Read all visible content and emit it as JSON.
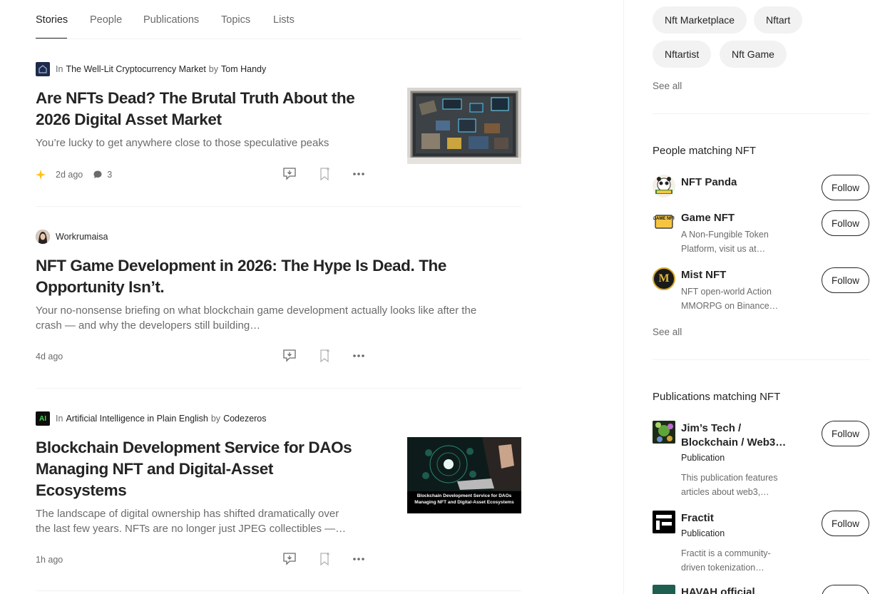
{
  "tabs": [
    "Stories",
    "People",
    "Publications",
    "Topics",
    "Lists"
  ],
  "stories": [
    {
      "in_label": "In",
      "publication": "The Well-Lit Cryptocurrency Market",
      "by_label": "by",
      "author": "Tom Handy",
      "title_line1": "Are NFTs Dead? The Brutal Truth About the",
      "title_line2": "2026 Digital Asset Market",
      "subtitle": "You’re lucky to get anywhere close to those speculative peaks",
      "age": "2d ago",
      "comments": "3"
    },
    {
      "author": "Workrumaisa",
      "title_line1": "NFT Game Development in 2026: The Hype Is Dead. The",
      "title_line2": "Opportunity Isn’t.",
      "subtitle_line1": "Your no-nonsense briefing on what blockchain game development actually looks like after the",
      "subtitle_line2": "crash — and why the developers still building…",
      "age": "4d ago"
    },
    {
      "in_label": "In",
      "publication": "Artificial Intelligence in Plain English",
      "by_label": "by",
      "author": "Codezeros",
      "pub_icon_text": "AI",
      "title_line1": "Blockchain Development Service for DAOs",
      "title_line2": "Managing NFT and Digital-Asset",
      "title_line3": "Ecosystems",
      "subtitle_line1": "The landscape of digital ownership has shifted dramatically over",
      "subtitle_line2": "the last few years. NFTs are no longer just JPEG collectibles —…",
      "age": "1h ago",
      "thumb_caption_line1": "Blockchain Development Service for DAOs",
      "thumb_caption_line2": "Managing NFT and Digital-Asset Ecosystems"
    }
  ],
  "sidebar": {
    "topics": [
      "Nft Marketplace",
      "Nftart",
      "Nftartist",
      "Nft Game"
    ],
    "see_all": "See all",
    "people_heading": "People matching NFT",
    "people": [
      {
        "name": "NFT Panda",
        "follow": "Follow"
      },
      {
        "name": "Game NFT",
        "desc_line1": "A Non-Fungible Token",
        "desc_line2": "Platform, visit us at…",
        "follow": "Follow",
        "avatar_text": "GAME NFT"
      },
      {
        "name": "Mist NFT",
        "desc_line1": "NFT open-world Action",
        "desc_line2": "MMORPG on Binance…",
        "follow": "Follow",
        "avatar_text": "M"
      }
    ],
    "pubs_heading": "Publications matching NFT",
    "publications": [
      {
        "name_line1": "Jim’s Tech /",
        "name_line2": "Blockchain / Web3…",
        "type": "Publication",
        "desc_line1": "This publication features",
        "desc_line2": "articles about web3,…",
        "follow": "Follow"
      },
      {
        "name": "Fractit",
        "type": "Publication",
        "desc_line1": "Fractit is a community-",
        "desc_line2": "driven tokenization…",
        "follow": "Follow"
      },
      {
        "name": "HAVAH official"
      }
    ]
  },
  "colors": {
    "text": "#242424",
    "muted": "#6b6b6b",
    "divider": "#f2f2f2",
    "star": "#ffc017"
  }
}
